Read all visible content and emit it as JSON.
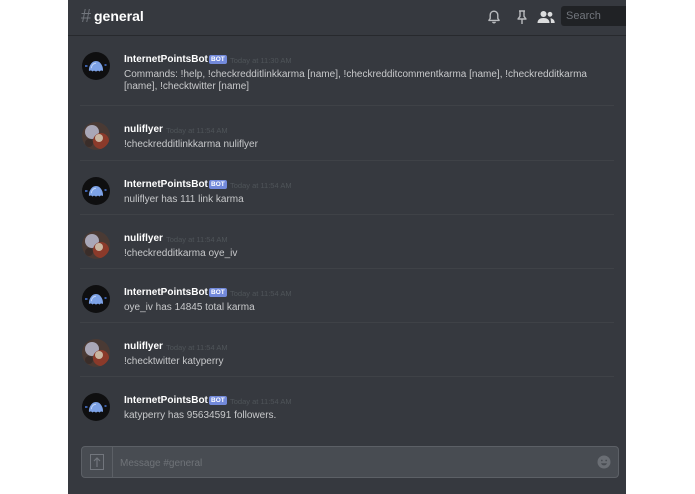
{
  "header": {
    "hash": "#",
    "channel": "general",
    "icons": [
      "bell-icon",
      "pin-icon",
      "members-icon"
    ],
    "search_placeholder": "Search"
  },
  "messages": [
    {
      "author": "InternetPointsBot",
      "bot": true,
      "bot_tag": "BOT",
      "time": "Today at 11:30 AM",
      "text": "Commands: !help, !checkredditlinkkarma [name], !checkredditcommentkarma [name], !checkredditkarma [name], !checktwitter [name]"
    },
    {
      "author": "nuliflyer",
      "bot": false,
      "time": "Today at 11:54 AM",
      "text": "!checkredditlinkkarma nuliflyer"
    },
    {
      "author": "InternetPointsBot",
      "bot": true,
      "bot_tag": "BOT",
      "time": "Today at 11:54 AM",
      "text": "nuliflyer has 111 link karma"
    },
    {
      "author": "nuliflyer",
      "bot": false,
      "time": "Today at 11:54 AM",
      "text": "!checkredditkarma oye_iv"
    },
    {
      "author": "InternetPointsBot",
      "bot": true,
      "bot_tag": "BOT",
      "time": "Today at 11:54 AM",
      "text": "oye_iv has 14845 total karma"
    },
    {
      "author": "nuliflyer",
      "bot": false,
      "time": "Today at 11:54 AM",
      "text": "!checktwitter katyperry"
    },
    {
      "author": "InternetPointsBot",
      "bot": true,
      "bot_tag": "BOT",
      "time": "Today at 11:54 AM",
      "text": "katyperry has 95634591 followers."
    }
  ],
  "composer": {
    "placeholder": "Message #general",
    "upload_icon": "upload-icon",
    "emoji_icon": "emoji-icon"
  },
  "colors": {
    "background": "#36393f",
    "bot_tag": "#7289da",
    "username": "#ffffff",
    "message_text": "#c8c9cb",
    "timestamp": "#4f5459"
  }
}
